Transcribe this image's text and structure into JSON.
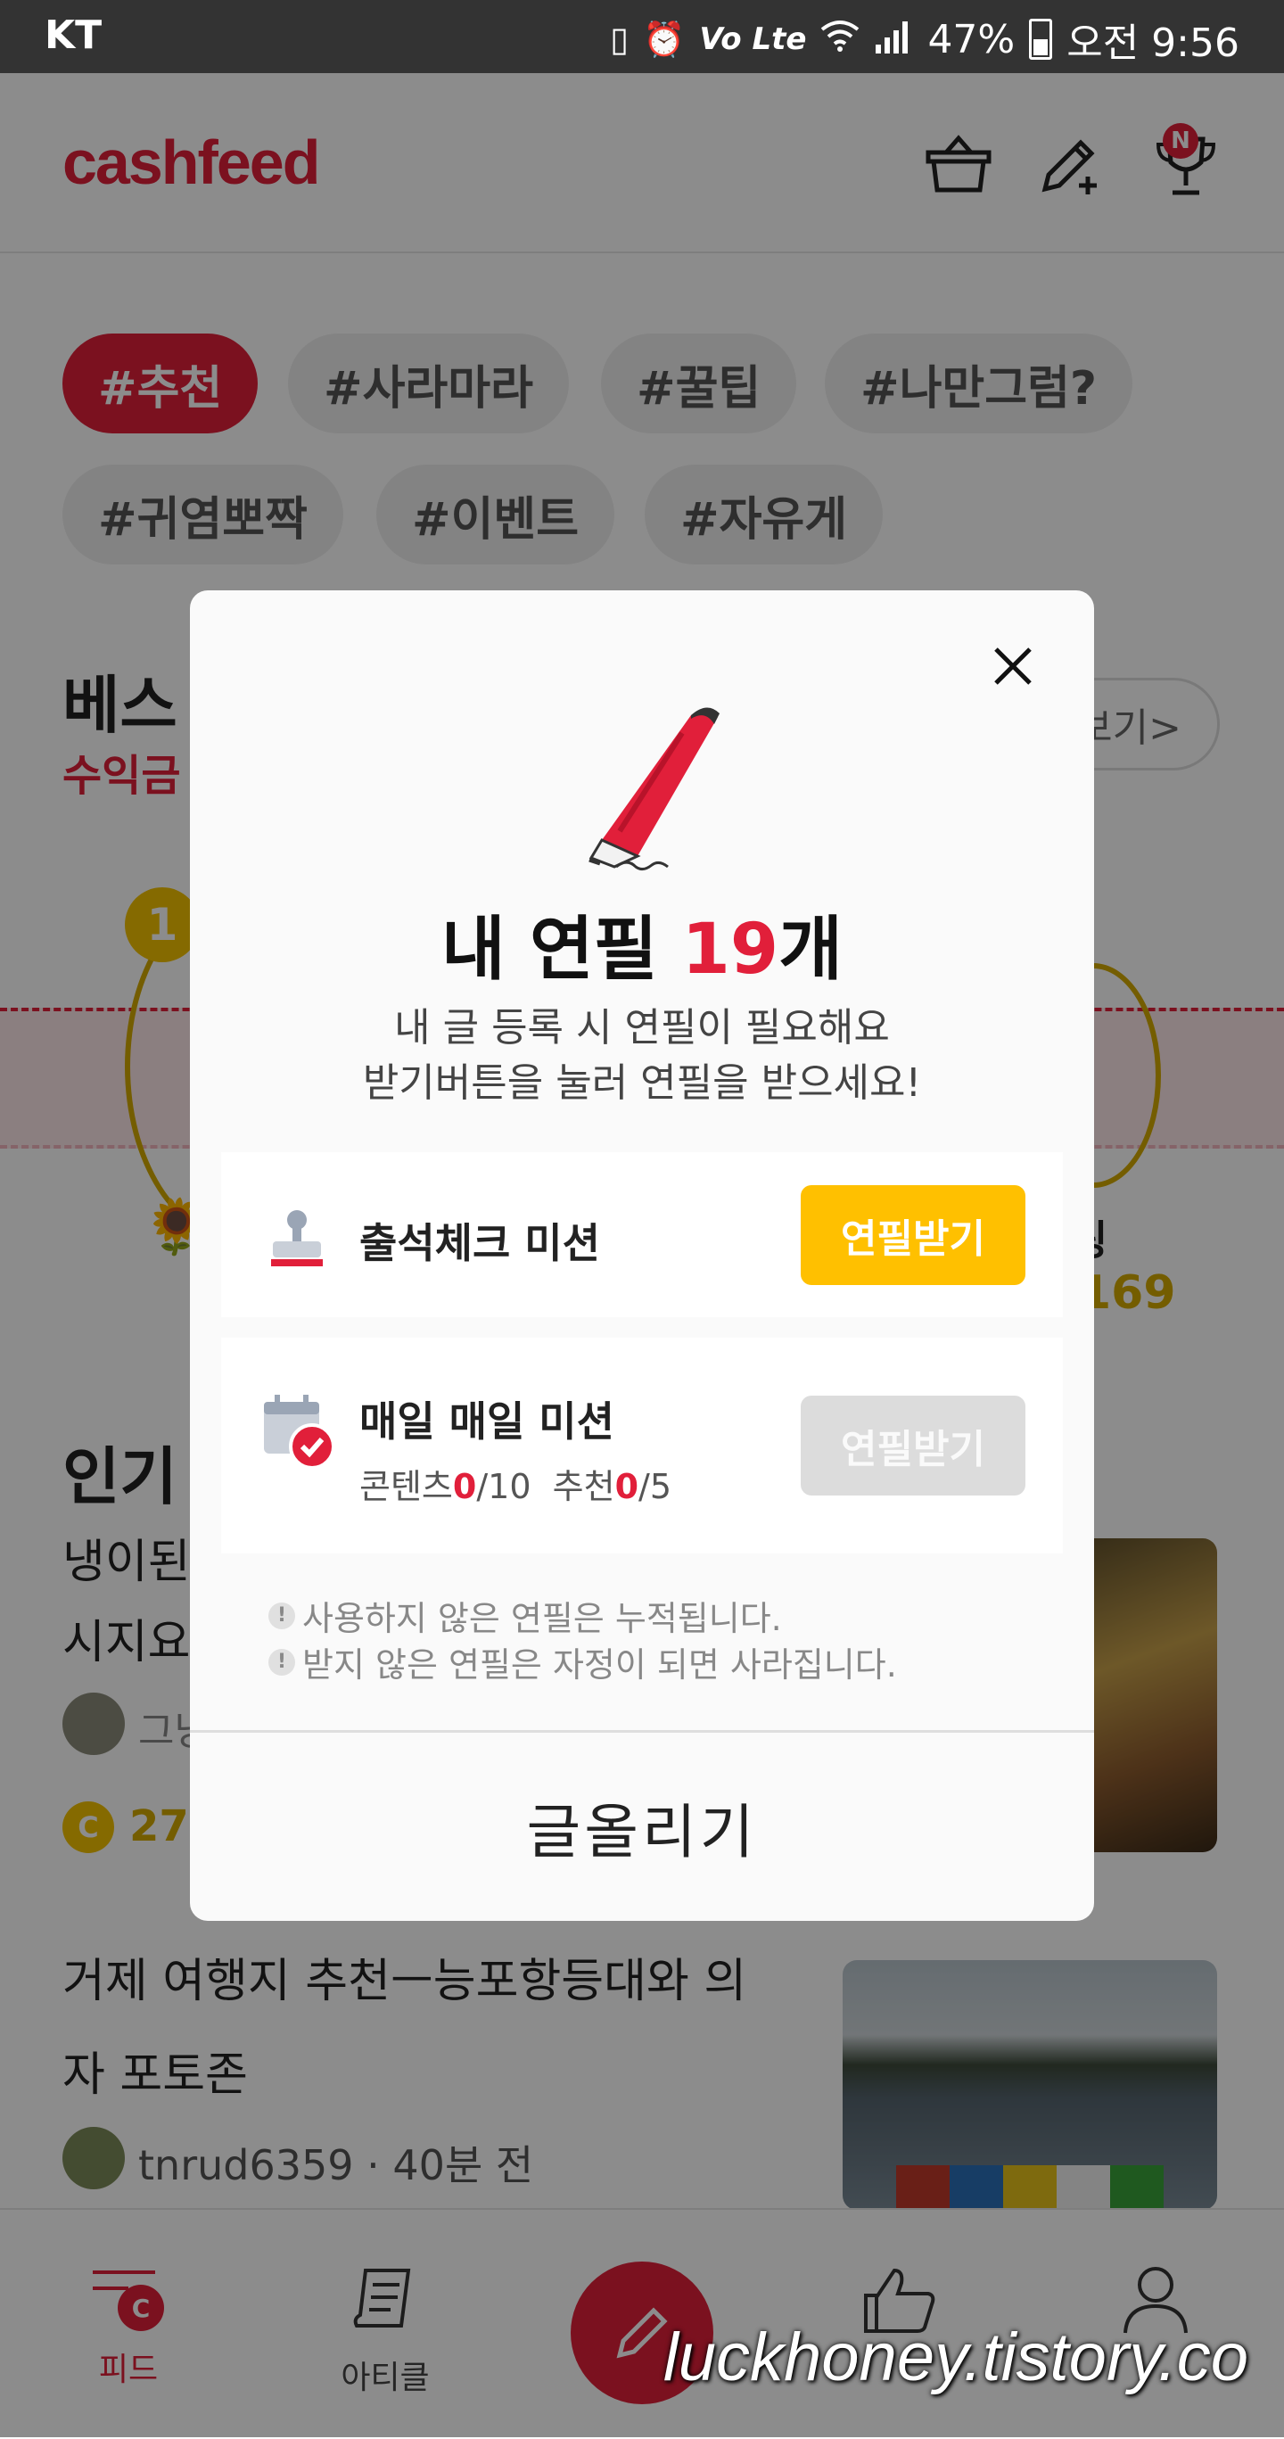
{
  "statusbar": {
    "carrier": "KT",
    "volte": "Vo Lte",
    "battery": "47%",
    "time": "오전 9:56"
  },
  "header": {
    "logo": "cashfeed",
    "badge": "N",
    "icons": [
      "basket-icon",
      "pencil-plus-icon",
      "trophy-icon"
    ]
  },
  "chips": [
    "#추천",
    "#사라마라",
    "#꿀팁",
    "#나만그럼?",
    "#귀염뽀짝",
    "#이벤트",
    "#자유게"
  ],
  "best": {
    "title_partial": "베스",
    "subtitle_partial": "수익금",
    "more_partial": "보기>",
    "rank_number": "1",
    "right_name_partial": "링",
    "right_points_partial": "169"
  },
  "popular": {
    "title_partial": "인기",
    "item1_line1_partial": "냉이된",
    "item1_line2_partial": "시지요",
    "item1_author_partial": "그냥",
    "item1_points": "27"
  },
  "feed_item2": {
    "line1": "거제 여행지 추천ㅡ능포항등대와 의",
    "line2": "자 포토존",
    "author": "tnrud6359",
    "time": "40분 전"
  },
  "bottomnav": {
    "feed": "피드",
    "article": "아티클",
    "feed_badge": "C"
  },
  "watermark": "luckhoney.tistory.co",
  "modal": {
    "title_prefix": "내 연필 ",
    "title_count": "19",
    "title_suffix": "개",
    "desc_line1": "내 글 등록 시 연필이 필요해요",
    "desc_line2": "받기버튼을 눌러 연필을 받으세요!",
    "mission1": {
      "label": "출석체크 미션",
      "button": "연필받기"
    },
    "mission2": {
      "label": "매일 매일 미션",
      "content_label": "콘텐츠",
      "content_done": "0",
      "content_total": "/10",
      "recommend_label": "추천",
      "recommend_done": "0",
      "recommend_total": "/5",
      "button": "연필받기"
    },
    "note1": "사용하지 않은 연필은 누적됩니다.",
    "note2": "받지 않은 연필은 자정이 되면 사라집니다.",
    "post_button": "글올리기"
  },
  "colors": {
    "brand_red": "#e11f3a",
    "button_yellow": "#ffc000",
    "button_disabled": "#dcdcdc"
  }
}
